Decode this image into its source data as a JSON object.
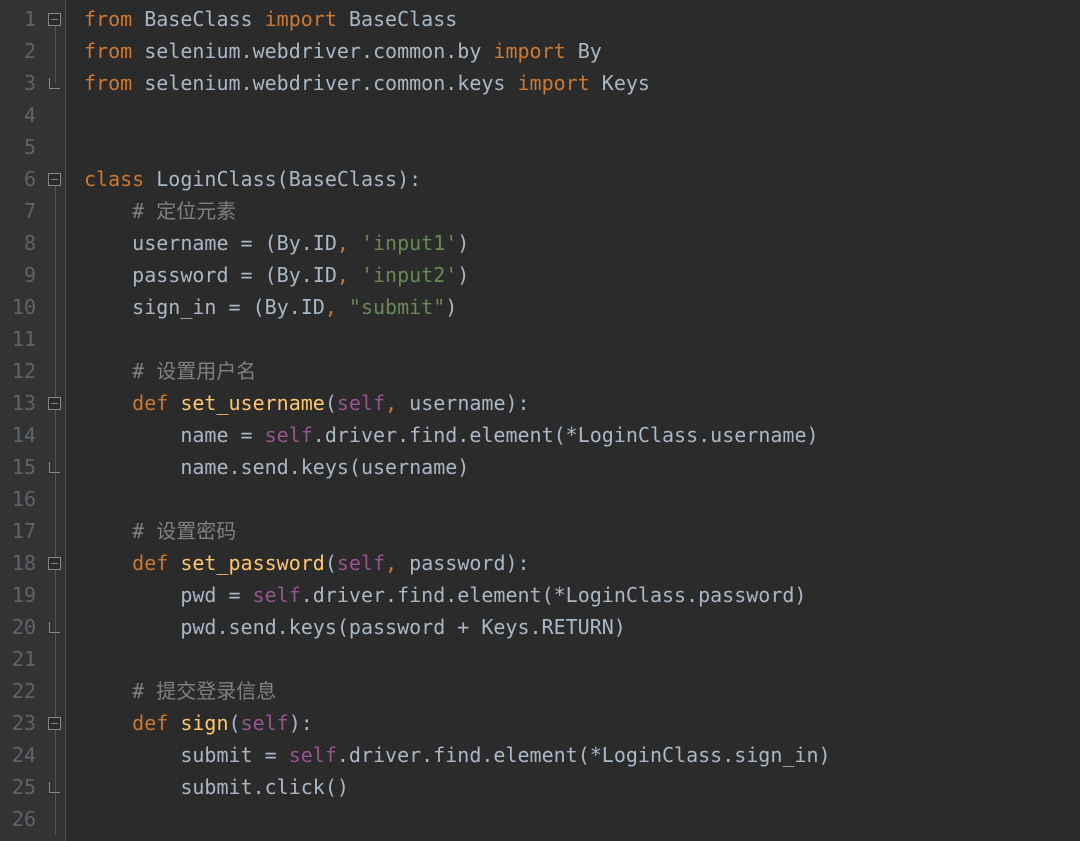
{
  "lineCount": 26,
  "foldMarks": {
    "1": "open-start",
    "2": "line",
    "3": "close",
    "6": "open-start",
    "7": "line",
    "8": "line",
    "9": "line",
    "10": "line",
    "11": "line",
    "12": "line",
    "13": "open",
    "14": "line",
    "15": "close-mid",
    "16": "line",
    "17": "line",
    "18": "open",
    "19": "line",
    "20": "close-mid",
    "21": "line",
    "22": "line",
    "23": "open",
    "24": "line",
    "25": "close-mid",
    "26": "line"
  },
  "code": [
    [
      {
        "c": "kw",
        "t": "from"
      },
      {
        "c": "",
        "t": " BaseClass "
      },
      {
        "c": "kw",
        "t": "import"
      },
      {
        "c": "",
        "t": " BaseClass"
      }
    ],
    [
      {
        "c": "kw",
        "t": "from"
      },
      {
        "c": "",
        "t": " selenium.webdriver.common.by "
      },
      {
        "c": "kw",
        "t": "import"
      },
      {
        "c": "",
        "t": " By"
      }
    ],
    [
      {
        "c": "kw",
        "t": "from"
      },
      {
        "c": "",
        "t": " selenium.webdriver.common.keys "
      },
      {
        "c": "kw",
        "t": "import"
      },
      {
        "c": "",
        "t": " Keys"
      }
    ],
    [],
    [],
    [
      {
        "c": "kw",
        "t": "class "
      },
      {
        "c": "",
        "t": "LoginClass(BaseClass):"
      }
    ],
    [
      {
        "c": "",
        "t": "    "
      },
      {
        "c": "comment",
        "t": "# 定位元素"
      }
    ],
    [
      {
        "c": "",
        "t": "    username = (By.ID"
      },
      {
        "c": "kw",
        "t": ", "
      },
      {
        "c": "str",
        "t": "'input1'"
      },
      {
        "c": "",
        "t": ")"
      }
    ],
    [
      {
        "c": "",
        "t": "    password = (By.ID"
      },
      {
        "c": "kw",
        "t": ", "
      },
      {
        "c": "str",
        "t": "'input2'"
      },
      {
        "c": "",
        "t": ")"
      }
    ],
    [
      {
        "c": "",
        "t": "    sign_in = (By.ID"
      },
      {
        "c": "kw",
        "t": ", "
      },
      {
        "c": "str",
        "t": "\"submit\""
      },
      {
        "c": "",
        "t": ")"
      }
    ],
    [],
    [
      {
        "c": "",
        "t": "    "
      },
      {
        "c": "comment",
        "t": "# 设置用户名"
      }
    ],
    [
      {
        "c": "",
        "t": "    "
      },
      {
        "c": "kw",
        "t": "def "
      },
      {
        "c": "fn",
        "t": "set_username"
      },
      {
        "c": "",
        "t": "("
      },
      {
        "c": "self",
        "t": "self"
      },
      {
        "c": "kw",
        "t": ", "
      },
      {
        "c": "",
        "t": "username):"
      }
    ],
    [
      {
        "c": "",
        "t": "        name = "
      },
      {
        "c": "self",
        "t": "self"
      },
      {
        "c": "",
        "t": ".driver.find.element(*LoginClass.username)"
      }
    ],
    [
      {
        "c": "",
        "t": "        name.send.keys(username)"
      }
    ],
    [],
    [
      {
        "c": "",
        "t": "    "
      },
      {
        "c": "comment",
        "t": "# 设置密码"
      }
    ],
    [
      {
        "c": "",
        "t": "    "
      },
      {
        "c": "kw",
        "t": "def "
      },
      {
        "c": "fn",
        "t": "set_password"
      },
      {
        "c": "",
        "t": "("
      },
      {
        "c": "self",
        "t": "self"
      },
      {
        "c": "kw",
        "t": ", "
      },
      {
        "c": "",
        "t": "password):"
      }
    ],
    [
      {
        "c": "",
        "t": "        pwd = "
      },
      {
        "c": "self",
        "t": "self"
      },
      {
        "c": "",
        "t": ".driver.find.element(*LoginClass.password)"
      }
    ],
    [
      {
        "c": "",
        "t": "        pwd.send.keys(password + Keys.RETURN)"
      }
    ],
    [],
    [
      {
        "c": "",
        "t": "    "
      },
      {
        "c": "comment",
        "t": "# 提交登录信息"
      }
    ],
    [
      {
        "c": "",
        "t": "    "
      },
      {
        "c": "kw",
        "t": "def "
      },
      {
        "c": "fn",
        "t": "sign"
      },
      {
        "c": "",
        "t": "("
      },
      {
        "c": "self",
        "t": "self"
      },
      {
        "c": "",
        "t": "):"
      }
    ],
    [
      {
        "c": "",
        "t": "        submit = "
      },
      {
        "c": "self",
        "t": "self"
      },
      {
        "c": "",
        "t": ".driver.find.element(*LoginClass.sign_in)"
      }
    ],
    [
      {
        "c": "",
        "t": "        submit.click()"
      }
    ],
    []
  ]
}
